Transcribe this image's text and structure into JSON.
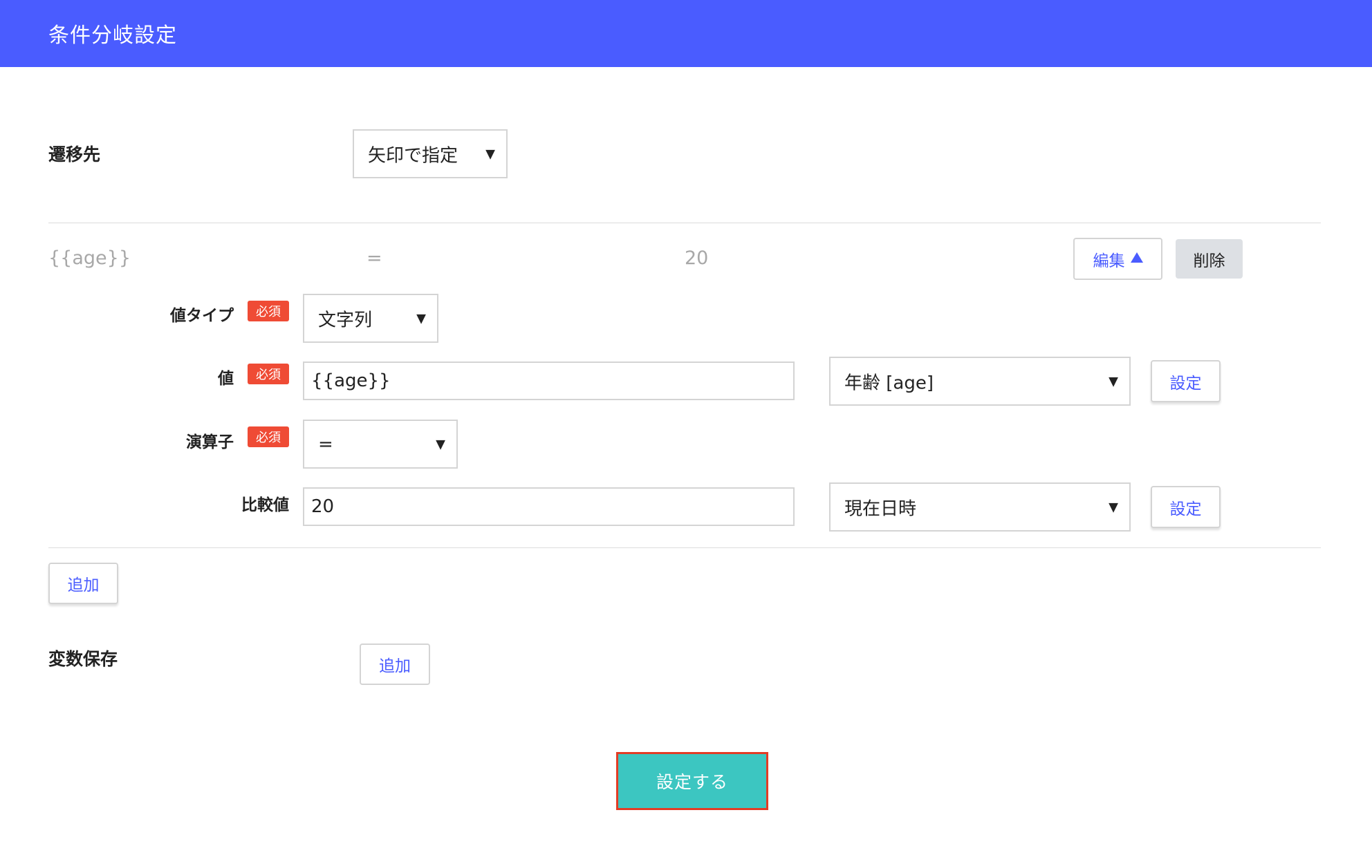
{
  "header": {
    "title": "条件分岐設定"
  },
  "transition": {
    "label": "遷移先",
    "selected": "矢印で指定"
  },
  "condition": {
    "summary": {
      "left": "{{age}}",
      "operator": "=",
      "right": "20"
    },
    "edit_label": "編集",
    "delete_label": "削除",
    "fields": {
      "value_type": {
        "label": "値タイプ",
        "required": "必須",
        "selected": "文字列"
      },
      "value": {
        "label": "値",
        "required": "必須",
        "input": "{{age}}",
        "variable_selected": "年齢 [age]",
        "set_label": "設定"
      },
      "operator": {
        "label": "演算子",
        "required": "必須",
        "selected": "="
      },
      "compare": {
        "label": "比較値",
        "input": "20",
        "variable_selected": "現在日時",
        "set_label": "設定"
      }
    }
  },
  "add_condition_label": "追加",
  "variable_save": {
    "label": "変数保存",
    "add_label": "追加"
  },
  "submit_label": "設定する",
  "colors": {
    "header": "#4a5cff",
    "submit": "#3cc6c1",
    "badge": "#ef4b35",
    "accent": "#4a5cff"
  },
  "icons": {
    "select_caret": "caret-down-icon",
    "edit_toggle": "triangle-up-icon"
  }
}
